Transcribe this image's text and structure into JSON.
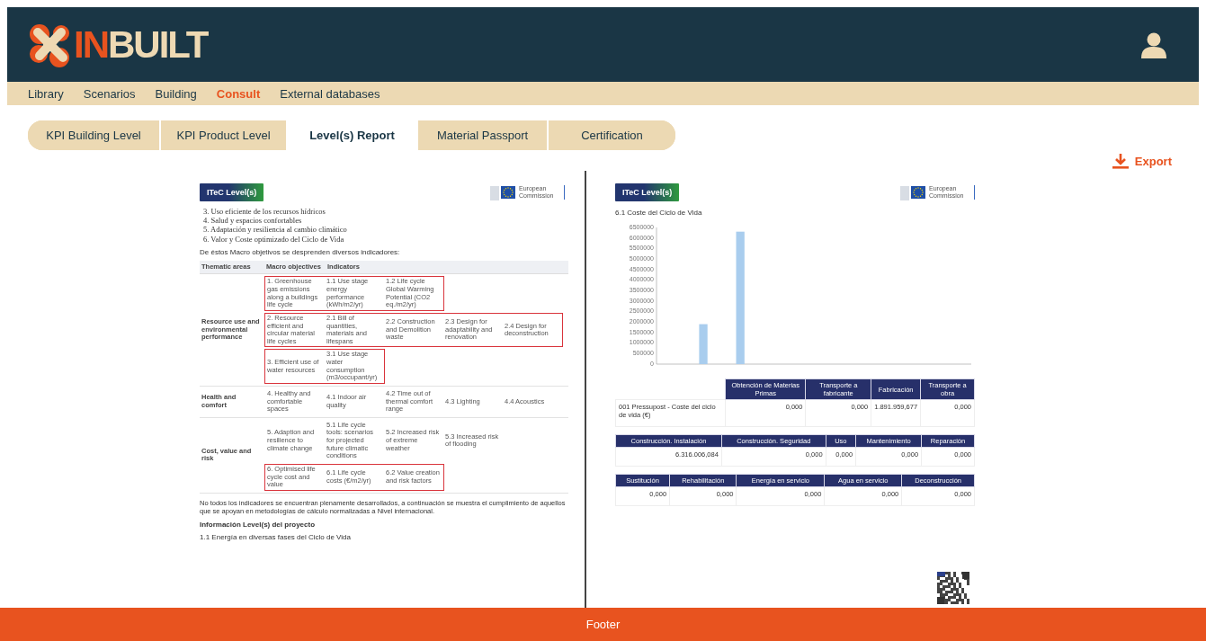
{
  "header": {
    "logo": [
      "IN",
      "BUILT"
    ]
  },
  "nav": [
    {
      "label": "Library",
      "selected": false
    },
    {
      "label": "Scenarios",
      "selected": false
    },
    {
      "label": "Building",
      "selected": false
    },
    {
      "label": "Consult",
      "selected": true
    },
    {
      "label": "External databases",
      "selected": false
    }
  ],
  "tabs": [
    {
      "label": "KPI Building Level",
      "selected": false
    },
    {
      "label": "KPI Product Level",
      "selected": false
    },
    {
      "label": "Level(s) Report",
      "selected": true
    },
    {
      "label": "Material Passport",
      "selected": false
    },
    {
      "label": "Certification",
      "selected": false
    }
  ],
  "export": {
    "label": "Export"
  },
  "left_page": {
    "badge": "ITeC Level(s)",
    "eu_label": "European Commission",
    "list": [
      "3. Uso eficiente de los recursos hídricos",
      "4. Salud y espacios confortables",
      "5. Adaptación y resiliencia al cambio climático",
      "6. Valor y Coste optimizado del Ciclo de Vida"
    ],
    "intro": "De éstos Macro objetivos se desprenden diversos indicadores:",
    "table": {
      "columns": [
        "Thematic areas",
        "Macro objectives",
        "Indicators"
      ],
      "groups": [
        {
          "area": "Resource use and environmental performance",
          "rows": [
            {
              "highlighted": true,
              "cells": [
                "1. Greenhouse gas emissions along a buildings life cycle",
                "1.1 Use stage energy performance (kWh/m2/yr)",
                "1.2 Life cycle Global Warming Potential (CO2 eq./m2/yr)"
              ]
            },
            {
              "highlighted": true,
              "cells": [
                "2. Resource efficient and circular material life cycles",
                "2.1 Bill of quantities, materials and lifespans",
                "2.2 Construction and Demolition waste",
                "2.3 Design for adaptability and renovation",
                "2.4 Design for deconstruction"
              ]
            },
            {
              "highlighted": true,
              "cells": [
                "3. Efficient use of water resources",
                "3.1 Use stage water consumption (m3/occupant/yr)"
              ]
            }
          ]
        },
        {
          "area": "Health and comfort",
          "rows": [
            {
              "highlighted": false,
              "cells": [
                "4. Healthy and comfortable spaces",
                "4.1 Indoor air quality",
                "4.2 Time out of thermal comfort range",
                "4.3 Lighting",
                "4.4 Acoustics"
              ]
            }
          ]
        },
        {
          "area": "Cost, value and risk",
          "rows": [
            {
              "highlighted": false,
              "cells": [
                "5. Adaption and resilience to climate change",
                "5.1 Life cycle tools: scenarios for projected future climatic conditions",
                "5.2 Increased risk of extreme weather",
                "5.3 Increased risk of flooding"
              ]
            },
            {
              "highlighted": true,
              "cells": [
                "6. Optimised life cycle cost and value",
                "6.1 Life cycle costs (€/m2/yr)",
                "6.2 Value creation and risk factors"
              ]
            }
          ]
        }
      ]
    },
    "note": "No todos los indicadores se encuentran plenamente desarrollados, a continuación se muestra el cumplimiento de aquellos que se apoyan en metodologías de cálculo normalizadas a Nivel internacional.",
    "heading": "Información Level(s) del proyecto",
    "subheading": "1.1 Energía en diversas fases del Ciclo de Vida"
  },
  "right_page": {
    "badge": "ITeC Level(s)",
    "eu_label": "European Commission",
    "section": "6.1 Coste del Ciclo de Vida",
    "chart_data": {
      "type": "bar",
      "ylim": [
        0,
        6500000
      ],
      "yticks": [
        0,
        500000,
        1000000,
        1500000,
        2000000,
        2500000,
        3000000,
        3500000,
        4000000,
        4500000,
        5000000,
        5500000,
        6000000,
        6500000
      ],
      "values": [
        0,
        0,
        1900000,
        0,
        6300000,
        0,
        0,
        0,
        0,
        0,
        0,
        0,
        0,
        0,
        0,
        0,
        0
      ]
    },
    "cost_tables": [
      {
        "row_label": "001 Pressupost - Coste del ciclo de vida (€)",
        "columns": [
          "Obtención de Materias Primas",
          "Transporte a fabricante",
          "Fabricación",
          "Transporte a obra"
        ],
        "values": [
          "0,000",
          "0,000",
          "1.891.959,677",
          "0,000"
        ]
      },
      {
        "columns": [
          "Construcción. Instalación",
          "Construcción. Seguridad",
          "Uso",
          "Mantenimiento",
          "Reparación"
        ],
        "values": [
          "6.316.006,084",
          "0,000",
          "0,000",
          "0,000",
          "0,000"
        ]
      },
      {
        "columns": [
          "Sustitución",
          "Rehabilitación",
          "Energía en servicio",
          "Agua en servicio",
          "Deconstrucción"
        ],
        "values": [
          "0,000",
          "0,000",
          "0,000",
          "0,000",
          "0,000"
        ]
      }
    ]
  },
  "footer": "Footer"
}
